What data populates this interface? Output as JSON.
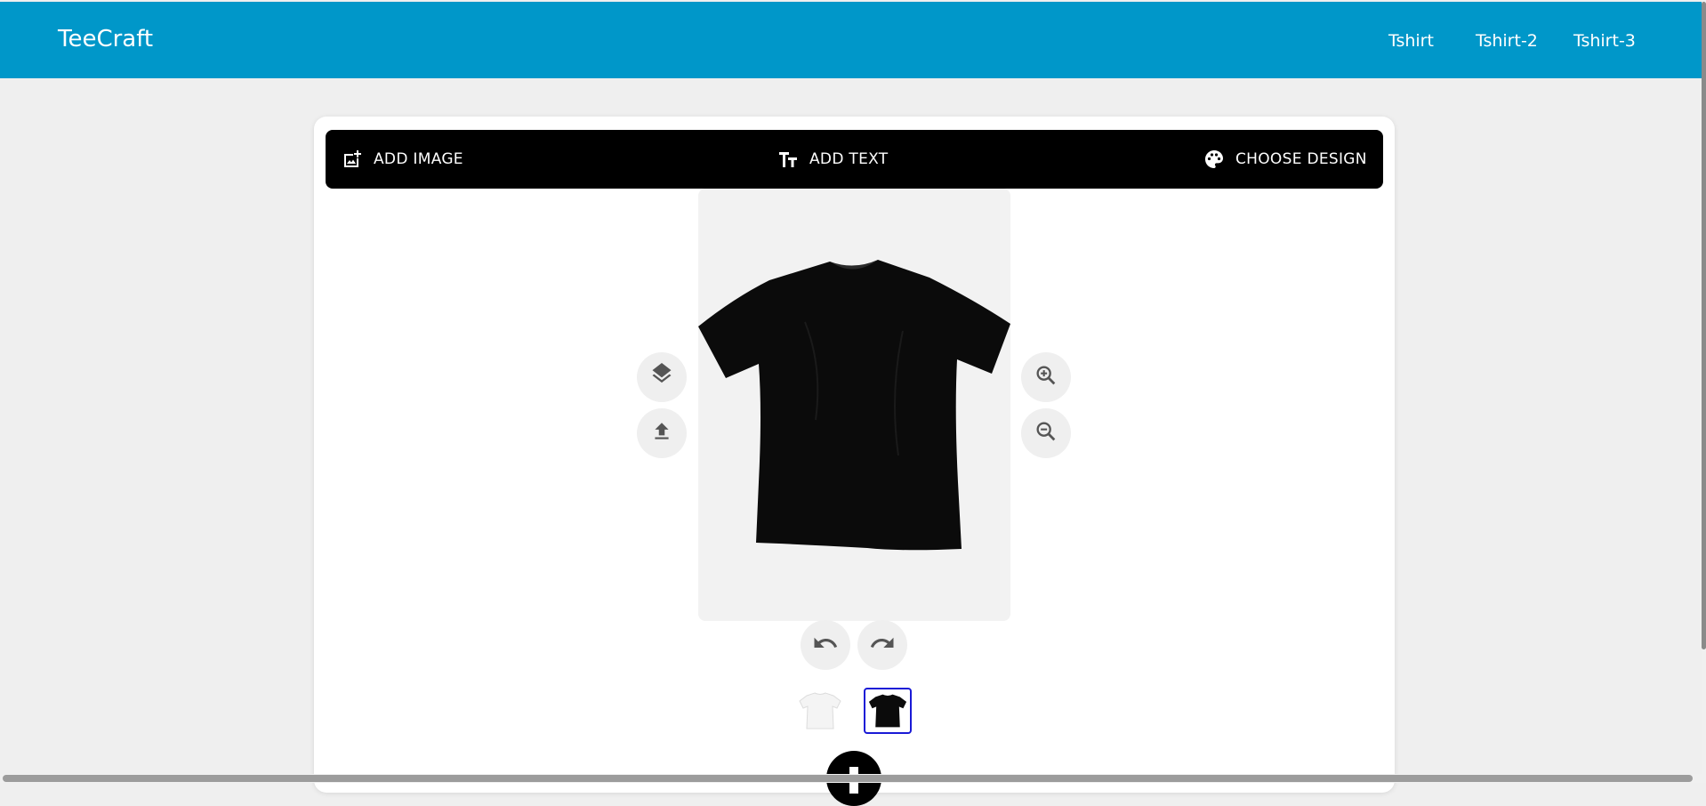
{
  "header": {
    "brand": "TeeCraft",
    "nav": [
      "Tshirt",
      "Tshirt-2",
      "Tshirt-3"
    ],
    "background_color": "#0097c9"
  },
  "toolbar": {
    "add_image": {
      "label": "ADD IMAGE",
      "icon": "add-photo-icon"
    },
    "add_text": {
      "label": "ADD TEXT",
      "icon": "text-fields-icon"
    },
    "choose_design": {
      "label": "CHOOSE DESIGN",
      "icon": "palette-icon"
    }
  },
  "canvas": {
    "product": "black t-shirt",
    "left_tools": [
      "layers-icon",
      "upload-icon"
    ],
    "right_tools": [
      "zoom-in-icon",
      "zoom-out-icon"
    ]
  },
  "history": [
    "undo-icon",
    "redo-icon"
  ],
  "color_variants": [
    {
      "color": "#ffffff",
      "selected": false
    },
    {
      "color": "#111111",
      "selected": true
    }
  ],
  "accent_selected_border": "#1a1ad6"
}
